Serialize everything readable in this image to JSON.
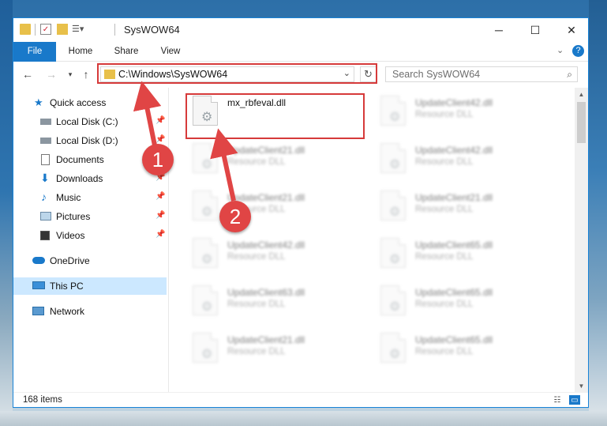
{
  "window": {
    "title": "SysWOW64"
  },
  "ribbon": {
    "tabs": [
      "File",
      "Home",
      "Share",
      "View"
    ]
  },
  "address": {
    "path": "C:\\Windows\\SysWOW64"
  },
  "search": {
    "placeholder": "Search SysWOW64"
  },
  "sidebar": {
    "items": [
      {
        "label": "Quick access",
        "icon": "star-icon"
      },
      {
        "label": "Local Disk (C:)",
        "icon": "drive-icon",
        "pinned": true
      },
      {
        "label": "Local Disk (D:)",
        "icon": "drive-icon",
        "pinned": true
      },
      {
        "label": "Documents",
        "icon": "documents-icon",
        "pinned": true
      },
      {
        "label": "Downloads",
        "icon": "downloads-icon",
        "pinned": true
      },
      {
        "label": "Music",
        "icon": "music-icon",
        "pinned": true
      },
      {
        "label": "Pictures",
        "icon": "pictures-icon",
        "pinned": true
      },
      {
        "label": "Videos",
        "icon": "videos-icon",
        "pinned": true
      },
      {
        "label": "OneDrive",
        "icon": "onedrive-icon"
      },
      {
        "label": "This PC",
        "icon": "pc-icon",
        "selected": true
      },
      {
        "label": "Network",
        "icon": "network-icon"
      }
    ]
  },
  "files": [
    {
      "name": "mx_rbfeval.dll",
      "type": "",
      "clear": true
    },
    {
      "name": "UpdateClient42.dll",
      "type": "Resource DLL"
    },
    {
      "name": "UpdateClient21.dll",
      "type": "Resource DLL"
    },
    {
      "name": "UpdateClient42.dll",
      "type": "Resource DLL"
    },
    {
      "name": "UpdateClient21.dll",
      "type": "Resource DLL"
    },
    {
      "name": "UpdateClient21.dll",
      "type": "Resource DLL"
    },
    {
      "name": "UpdateClient42.dll",
      "type": "Resource DLL"
    },
    {
      "name": "UpdateClient65.dll",
      "type": "Resource DLL"
    },
    {
      "name": "UpdateClient63.dll",
      "type": "Resource DLL"
    },
    {
      "name": "UpdateClient65.dll",
      "type": "Resource DLL"
    },
    {
      "name": "UpdateClient21.dll",
      "type": "Resource DLL"
    },
    {
      "name": "UpdateClient65.dll",
      "type": "Resource DLL"
    }
  ],
  "status": {
    "item_count": "168 items"
  },
  "callouts": [
    "1",
    "2"
  ],
  "colors": {
    "accent": "#1979ca",
    "highlight": "#d63a3a",
    "selected": "#cce8ff"
  }
}
